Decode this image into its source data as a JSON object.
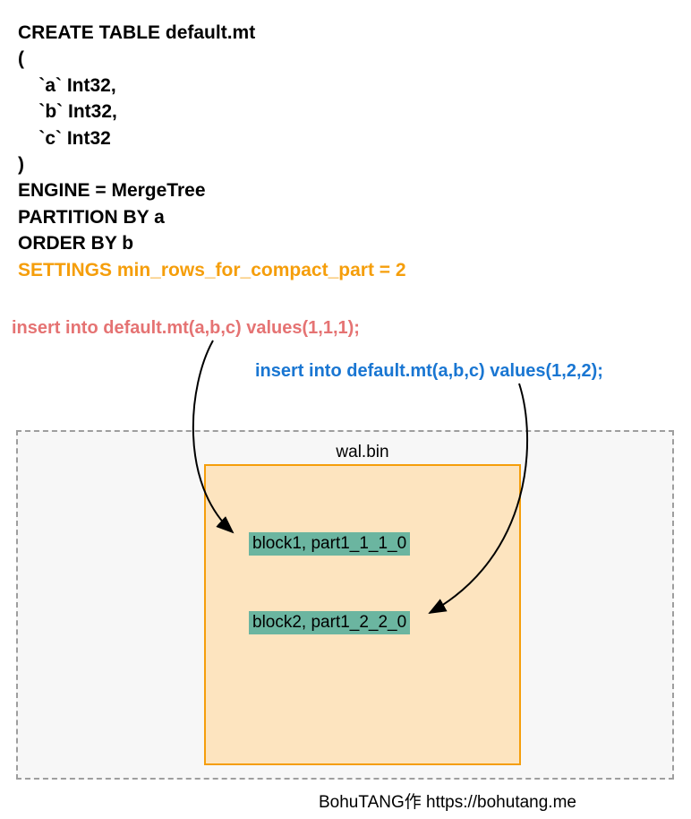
{
  "sql": {
    "line1": "CREATE TABLE default.mt",
    "line2": "(",
    "line3": "    `a` Int32,",
    "line4": "    `b` Int32,",
    "line5": "    `c` Int32",
    "line6": ")",
    "line7": "ENGINE = MergeTree",
    "line8": "PARTITION BY a",
    "line9": "ORDER BY b",
    "settings": "SETTINGS min_rows_for_compact_part = 2"
  },
  "inserts": {
    "insert1": "insert into default.mt(a,b,c) values(1,1,1);",
    "insert2": "insert into default.mt(a,b,c) values(1,2,2);"
  },
  "wal": {
    "label": "wal.bin",
    "block1": "block1, part1_1_1_0",
    "block2": "block2, part1_2_2_0"
  },
  "credit": "BohuTANG作 https://bohutang.me",
  "colors": {
    "settings": "#f59e0b",
    "insert1": "#e57373",
    "insert2": "#1976d2",
    "walBorder": "#f59e0b",
    "walFill": "#fde4bf",
    "blockBg": "#6bb5a0",
    "storageBorder": "#9e9e9e",
    "storageFill": "#f7f7f7"
  }
}
